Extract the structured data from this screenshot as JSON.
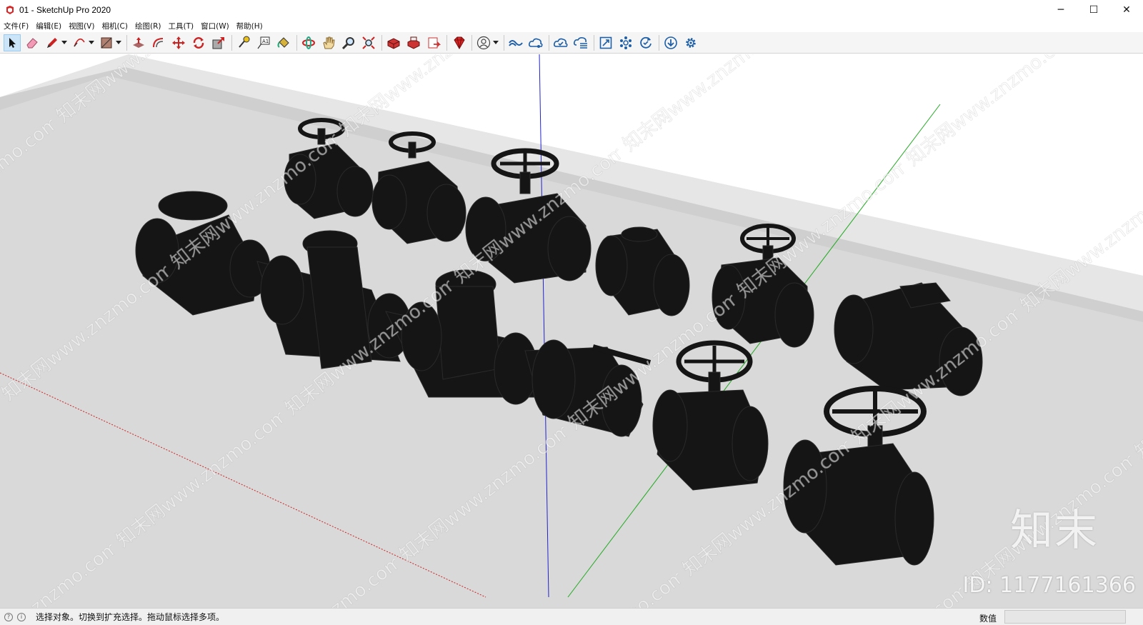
{
  "window": {
    "title": "01 - SketchUp Pro 2020",
    "minimize_glyph": "─",
    "maximize_glyph": "☐",
    "close_glyph": "✕"
  },
  "menu": {
    "items": [
      "文件(F)",
      "编辑(E)",
      "视图(V)",
      "相机(C)",
      "绘图(R)",
      "工具(T)",
      "窗口(W)",
      "帮助(H)"
    ]
  },
  "toolbar": {
    "tools": [
      {
        "name": "select-tool",
        "icon": "select-arrow-icon",
        "active": true
      },
      {
        "name": "eraser-tool",
        "icon": "eraser-icon"
      },
      {
        "name": "line-tool",
        "icon": "pencil-icon",
        "dropdown": true
      },
      {
        "name": "arc-tool",
        "icon": "arc-icon",
        "dropdown": true
      },
      {
        "name": "rectangle-tool",
        "icon": "rectangle-icon",
        "dropdown": true
      },
      {
        "name": "push-pull-tool",
        "icon": "push-pull-icon"
      },
      {
        "name": "offset-tool",
        "icon": "offset-icon"
      },
      {
        "name": "move-tool",
        "icon": "move-icon"
      },
      {
        "name": "rotate-tool",
        "icon": "rotate-icon"
      },
      {
        "name": "scale-tool",
        "icon": "scale-icon"
      },
      {
        "name": "tape-measure-tool",
        "icon": "tape-measure-icon"
      },
      {
        "name": "text-tool",
        "icon": "text-icon"
      },
      {
        "name": "paint-bucket-tool",
        "icon": "paint-bucket-icon"
      },
      {
        "name": "orbit-tool",
        "icon": "orbit-icon"
      },
      {
        "name": "pan-tool",
        "icon": "pan-hand-icon"
      },
      {
        "name": "zoom-tool",
        "icon": "zoom-icon"
      },
      {
        "name": "zoom-extents-tool",
        "icon": "zoom-extents-icon"
      },
      {
        "name": "3d-warehouse-button",
        "icon": "warehouse-icon"
      },
      {
        "name": "extension-warehouse-button",
        "icon": "extension-warehouse-icon"
      },
      {
        "name": "send-to-layout-button",
        "icon": "layout-icon"
      },
      {
        "name": "extension-manager-button",
        "icon": "ruby-gem-icon"
      },
      {
        "name": "account-button",
        "icon": "user-circle-icon",
        "dropdown": true
      },
      {
        "name": "trimble-connect-button",
        "icon": "trimble-connect-icon"
      },
      {
        "name": "collaborate-button",
        "icon": "cloud-share-icon"
      },
      {
        "name": "cloud-sync-button",
        "icon": "cloud-check-icon"
      },
      {
        "name": "cloud-layers-button",
        "icon": "cloud-list-icon"
      },
      {
        "name": "scan-essentials-button",
        "icon": "frame-icon"
      },
      {
        "name": "model-info-button",
        "icon": "nodes-icon"
      },
      {
        "name": "refresh-button",
        "icon": "refresh-check-icon"
      },
      {
        "name": "import-button",
        "icon": "download-circle-icon"
      },
      {
        "name": "settings-button",
        "icon": "gear-icon"
      }
    ]
  },
  "viewport": {
    "watermark_brand": "知末",
    "watermark_id": "ID: 1177161366",
    "watermark_tile": "知末网www.znzmo.com",
    "axis_colors": {
      "blue": "#2222cc",
      "green": "#22aa22",
      "red": "#cc2222"
    },
    "ground_color": "#d9d9d9",
    "model_color": "#151515"
  },
  "status": {
    "icon1": "?",
    "icon2": "i",
    "text": "选择对象。切换到扩充选择。拖动鼠标选择多项。",
    "measurements_label": "数值"
  }
}
